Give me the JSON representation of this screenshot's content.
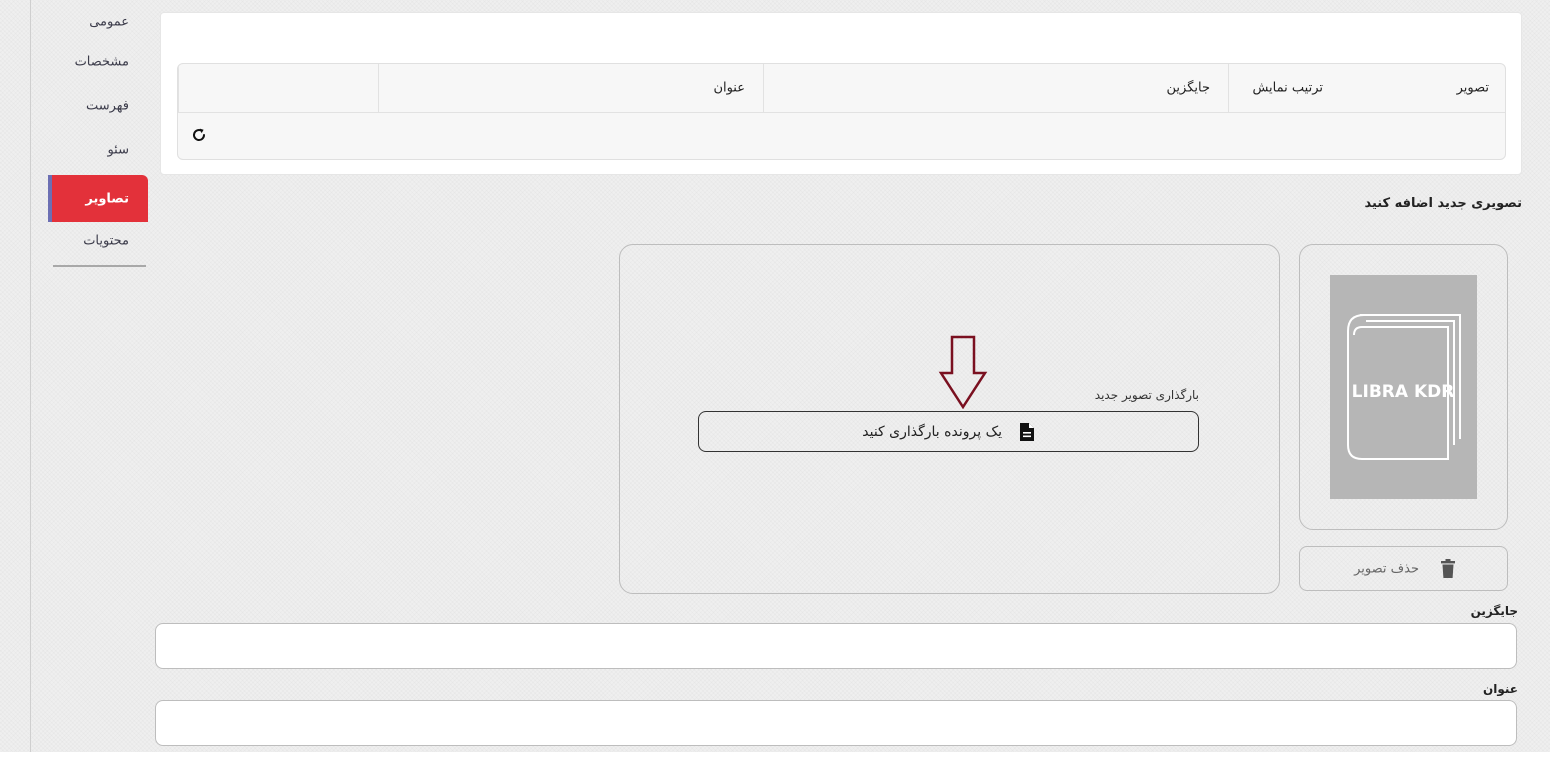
{
  "sidebar": {
    "items": [
      {
        "label": "عمومی",
        "active": false
      },
      {
        "label": "مشخصات",
        "active": false
      },
      {
        "label": "فهرست",
        "active": false
      },
      {
        "label": "سئو",
        "active": false
      },
      {
        "label": "تصاویر",
        "active": true
      },
      {
        "label": "محتویات",
        "active": false
      }
    ]
  },
  "images_table": {
    "columns": [
      "تصویر",
      "ترتیب نمایش",
      "جایگزین",
      "عنوان",
      ""
    ]
  },
  "new_image": {
    "section_title": "تصویری جدید اضافه کنید",
    "upload_label": "بارگذاری تصویر جدید",
    "upload_button": "یک پرونده بارگذاری کنید",
    "preview_placeholder_text": "LIBRA KDR",
    "delete_button": "حذف تصویر",
    "alt_label": "جایگزین",
    "alt_value": "",
    "title_label": "عنوان",
    "title_value": ""
  },
  "colors": {
    "active_tab": "#e3313a",
    "active_tab_border": "#6c6fb3",
    "annotation_arrow": "#7a1020",
    "placeholder_image": "#b6b6b6"
  },
  "icons": [
    "refresh-icon",
    "file-icon",
    "trash-icon",
    "down-arrow-annotation"
  ]
}
